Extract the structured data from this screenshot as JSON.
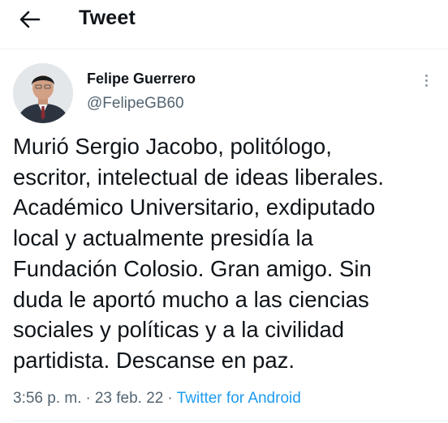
{
  "header": {
    "back_icon": "arrow-left-icon",
    "title": "Tweet"
  },
  "tweet": {
    "author": {
      "display_name": "Felipe Guerrero",
      "handle": "@FelipeGB60",
      "avatar": "avatar-photo"
    },
    "more_icon": "more-vertical-icon",
    "text": "Murió Sergio Jacobo, politólogo,\nescritor, intelectual de ideas liberales.\nAcadémico Universitario, exdiputado\nlocal y actualmente presidía la\nFundación Colosio. Gran amigo. Sin\nduda le aportó mucho a las ciencias\nsociales y políticas y a la civilidad\npartidista. Descanse en paz.",
    "time": "3:56 p. m.",
    "separator": "·",
    "date": "23 feb. 22",
    "source": "Twitter for Android"
  },
  "colors": {
    "text": "#0f1419",
    "secondary": "#536471",
    "link": "#1d9bf0"
  }
}
